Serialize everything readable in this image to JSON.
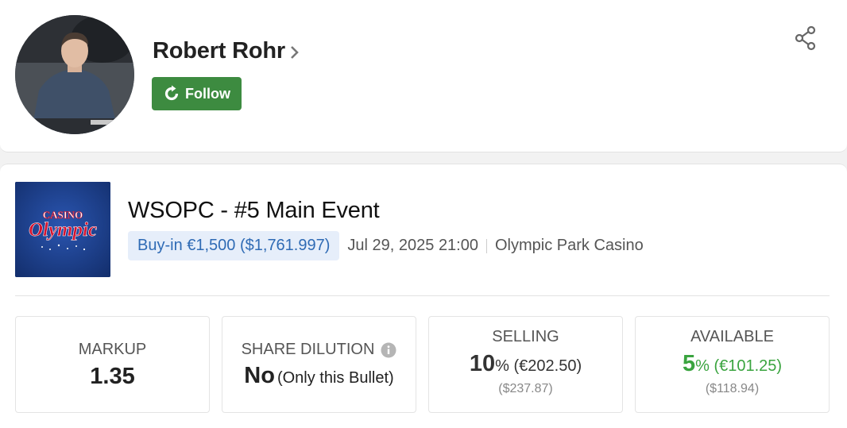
{
  "profile": {
    "name": "Robert Rohr",
    "follow_label": "Follow"
  },
  "event": {
    "logo_text_top": "CASINO",
    "logo_text_main": "Olympic",
    "title": "WSOPC - #5 Main Event",
    "buyin": "Buy-in €1,500 ($1,761.997)",
    "date": "Jul 29, 2025 21:00",
    "venue": "Olympic Park Casino"
  },
  "stats": {
    "markup": {
      "label": "MARKUP",
      "value": "1.35"
    },
    "dilution": {
      "label": "SHARE DILUTION",
      "value": "No",
      "note": "(Only this Bullet)"
    },
    "selling": {
      "label": "SELLING",
      "percent": "10",
      "percent_sign": "%",
      "amount": "(€202.50)",
      "usd": "($237.87)"
    },
    "available": {
      "label": "AVAILABLE",
      "percent": "5",
      "percent_sign": "%",
      "amount": "(€101.25)",
      "usd": "($118.94)"
    }
  },
  "colors": {
    "follow_button": "#3d8b40",
    "buyin_badge_bg": "#e6eefa",
    "buyin_badge_text": "#2f6bb5",
    "available_green": "#3aa43f"
  },
  "icons": {
    "chevron": "chevron-right-icon",
    "follow": "follow-refresh-icon",
    "share": "share-icon",
    "info": "info-icon"
  }
}
